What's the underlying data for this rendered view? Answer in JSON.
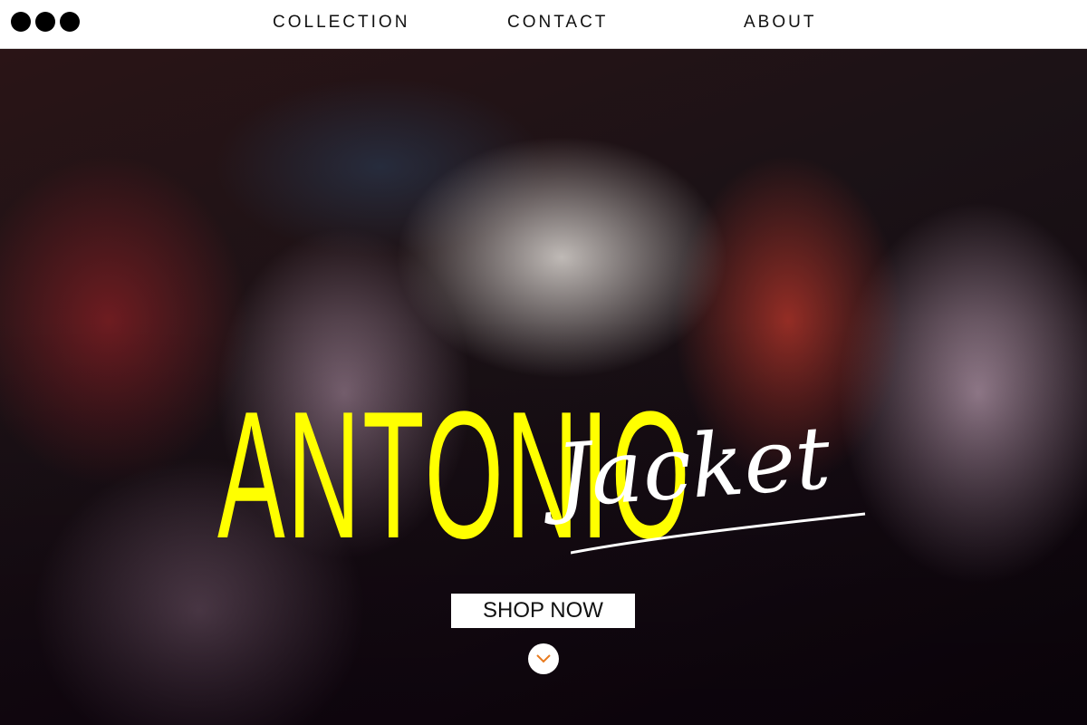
{
  "nav": {
    "links": [
      "COLLECTION",
      "CONTACT",
      "ABOUT"
    ]
  },
  "hero": {
    "title_main": "ANTONIO",
    "title_script": "Jacket",
    "cta_label": "SHOP NOW"
  },
  "colors": {
    "accent": "#ffff00",
    "text_light": "#ffffff",
    "nav_bg": "#ffffff",
    "scroll_chevron": "#e87a1e"
  },
  "icons": {
    "window_controls": "three-dots-icon",
    "scroll_down": "chevron-down-icon"
  }
}
